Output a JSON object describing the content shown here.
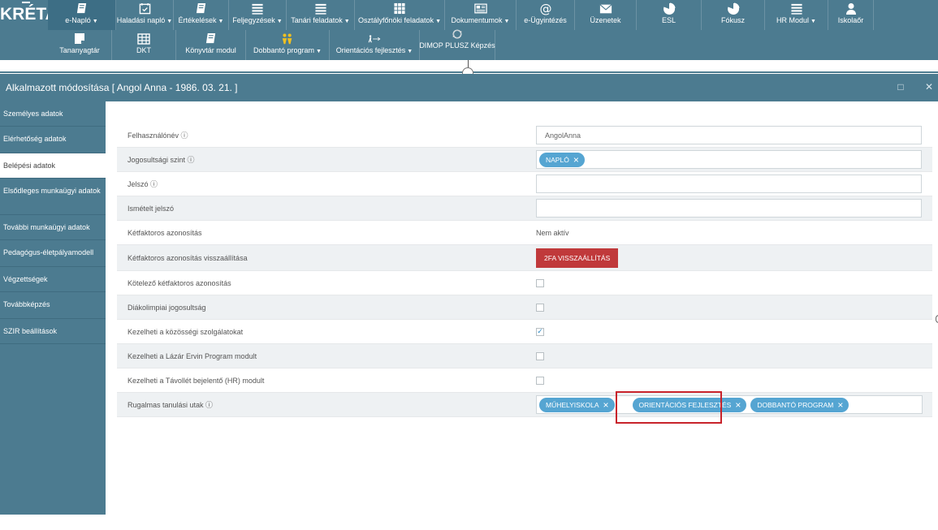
{
  "app": {
    "logo": "KRÉTA"
  },
  "nav": {
    "row1": [
      {
        "label": "e-Napló",
        "icon": "book-icon",
        "caret": true,
        "active": true,
        "width": 84
      },
      {
        "label": "Haladási napló",
        "icon": "calendar-check-icon",
        "caret": true,
        "width": 71
      },
      {
        "label": "Értékelések",
        "icon": "book-icon",
        "caret": true,
        "width": 68
      },
      {
        "label": "Feljegyzések",
        "icon": "list-icon",
        "caret": true,
        "width": 71
      },
      {
        "label": "Tanári feladatok",
        "icon": "list-icon",
        "caret": true,
        "width": 84
      },
      {
        "label": "Osztályfőnöki feladatok",
        "icon": "grid-icon",
        "caret": true,
        "width": 111
      },
      {
        "label": "Dokumentumok",
        "icon": "newspaper-icon",
        "caret": true,
        "width": 88
      },
      {
        "label": "e-Ügyintézés",
        "icon": "at-icon",
        "caret": false,
        "width": 72
      },
      {
        "label": "Üzenetek",
        "icon": "envelope-icon",
        "caret": false,
        "width": 76
      },
      {
        "label": "ESL",
        "icon": "pie-chart-icon",
        "caret": false,
        "width": 80
      },
      {
        "label": "Fókusz",
        "icon": "pie-chart-icon",
        "caret": false,
        "width": 78
      },
      {
        "label": "HR Modul",
        "icon": "list-icon",
        "caret": true,
        "width": 78
      },
      {
        "label": "Iskolaőr",
        "icon": "user-icon",
        "caret": false,
        "width": 56
      }
    ],
    "row2": [
      {
        "label": "Tananyagtár",
        "icon": "note-icon",
        "caret": false,
        "width": 79
      },
      {
        "label": "DKT",
        "icon": "table-icon",
        "caret": false,
        "width": 79
      },
      {
        "label": "Könyvtár modul",
        "icon": "book-icon",
        "caret": false,
        "width": 86
      },
      {
        "label": "Dobbantó program",
        "icon": "people-icon",
        "caret": true,
        "width": 103
      },
      {
        "label": "Orientációs fejlesztés",
        "icon": "person-arrow-icon",
        "caret": true,
        "width": 111
      },
      {
        "label": "DIMOP PLUSZ Képzés",
        "icon": "refresh-icon",
        "caret": false,
        "width": 93
      }
    ]
  },
  "window": {
    "title": "Alkalmazott módosítása [ Angol Anna - 1986. 03. 21. ]",
    "maximize_icon": "□",
    "close_icon": "✕"
  },
  "sidebar": {
    "items": [
      {
        "label": "Személyes adatok",
        "active": false,
        "height": 31
      },
      {
        "label": "Elérhetőség adatok",
        "active": false,
        "height": 33
      },
      {
        "label": "Belépési adatok",
        "active": true,
        "height": 31
      },
      {
        "label": "Elsődleges munkaügyi adatok",
        "active": false,
        "height": 45
      },
      {
        "label": "További munkaügyi adatok",
        "active": false,
        "height": 31
      },
      {
        "label": "Pedagógus-életpályamodell",
        "active": false,
        "height": 33
      },
      {
        "label": "Végzettségek",
        "active": false,
        "height": 31
      },
      {
        "label": "Továbbképzés",
        "active": false,
        "height": 33
      },
      {
        "label": "SZIR beállítások",
        "active": false,
        "height": 31
      }
    ]
  },
  "form": {
    "username": {
      "label": "Felhasználónév ⓘ",
      "value": "AngolAnna"
    },
    "permission": {
      "label": "Jogosultsági szint ⓘ",
      "tags": [
        "NAPLÓ"
      ]
    },
    "password": {
      "label": "Jelszó ⓘ",
      "value": ""
    },
    "password_repeat": {
      "label": "Ismételt jelszó",
      "value": ""
    },
    "twofa": {
      "label": "Kétfaktoros azonosítás",
      "value": "Nem aktív"
    },
    "twofa_reset": {
      "label": "Kétfaktoros azonosítás visszaállítása",
      "button": "2FA VISSZAÁLLÍTÁS"
    },
    "twofa_required": {
      "label": "Kötelező kétfaktoros azonosítás",
      "checked": false
    },
    "student_olympics": {
      "label": "Diákolimpiai jogosultság",
      "checked": false
    },
    "community_service": {
      "label": "Kezelheti a közösségi szolgálatokat",
      "checked": true
    },
    "lazar_ervin": {
      "label": "Kezelheti a Lázár Ervin Program modult",
      "checked": false
    },
    "absence_hr": {
      "label": "Kezelheti a Távollét bejelentő (HR) modult",
      "checked": false
    },
    "flexible_paths": {
      "label": "Rugalmas tanulási utak ⓘ",
      "tags": [
        "MŰHELYISKOLA",
        "ORIENTÁCIÓS FEJLESZTÉS",
        "DOBBANTÓ PROGRAM"
      ]
    }
  },
  "colors": {
    "primary": "#4c7b90",
    "tag": "#55a5d2",
    "danger": "#c0393b",
    "highlight": "#c8232b"
  }
}
